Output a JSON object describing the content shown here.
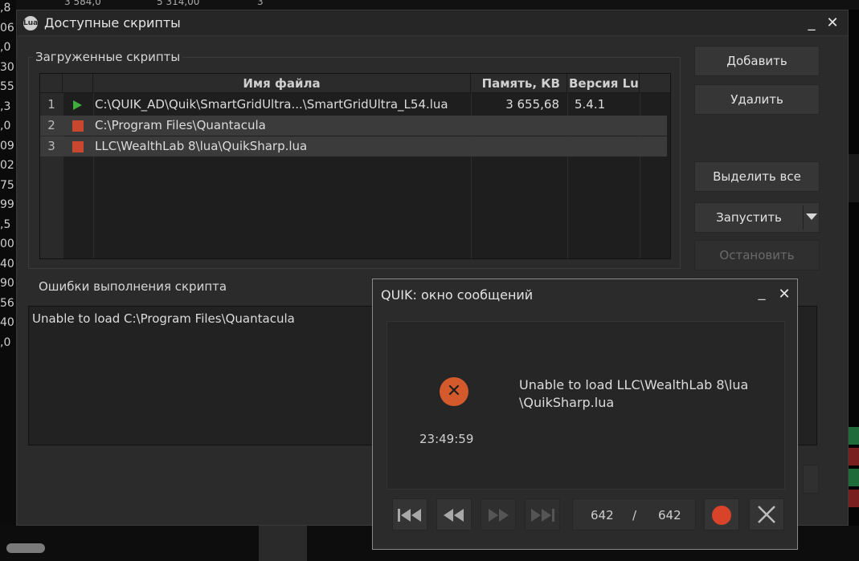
{
  "background": {
    "left_numbers": [
      ",8",
      "06",
      ",0",
      "30",
      "55",
      ",3",
      ",0",
      "09",
      "02",
      "75",
      "99",
      ",5",
      "00",
      "40",
      "90",
      "56",
      "40",
      ",0"
    ],
    "top_values": [
      "3 584,0",
      "5 314,00",
      "3"
    ]
  },
  "window": {
    "title": "Доступные скрипты",
    "icon_label": "Lua",
    "minimize": "_",
    "close": "✕"
  },
  "loaded": {
    "group_label": "Загруженные скрипты",
    "columns": [
      "Имя файла",
      "Память, КВ",
      "Версия Lua"
    ],
    "rows": [
      {
        "num": "1",
        "status": "running",
        "file": "C:\\QUIK_AD\\Quik\\SmartGridUltra...\\SmartGridUltra_L54.lua",
        "memory": "3 655,68",
        "version": "5.4.1"
      },
      {
        "num": "2",
        "status": "stopped",
        "file": "C:\\Program Files\\Quantacula",
        "memory": "",
        "version": ""
      },
      {
        "num": "3",
        "status": "stopped",
        "file": " LLC\\WealthLab 8\\lua\\QuikSharp.lua",
        "memory": "",
        "version": ""
      }
    ]
  },
  "buttons": {
    "add": "Добавить",
    "remove": "Удалить",
    "select_all": "Выделить все",
    "run": "Запустить",
    "stop": "Остановить"
  },
  "errors": {
    "label": "Ошибки выполнения скрипта",
    "text": "Unable to load C:\\Program Files\\Quantacula"
  },
  "dialog": {
    "title": "QUIK: окно сообщений",
    "minimize": "_",
    "close": "✕",
    "message_line1": "Unable to load  LLC\\WealthLab 8\\lua",
    "message_line2": "\\QuikSharp.lua",
    "time": "23:49:59",
    "counter_current": "642",
    "counter_sep": "/",
    "counter_total": "642"
  },
  "colors": {
    "play": "#3fae3f",
    "stop": "#c9472e",
    "error": "#d45a2c"
  }
}
